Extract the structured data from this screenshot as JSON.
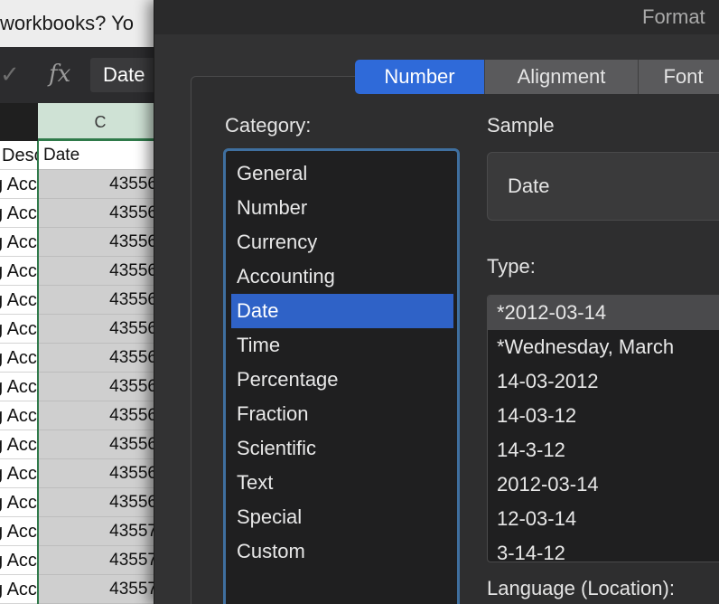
{
  "notice": {
    "text": "workbooks?  Yo"
  },
  "formula_bar": {
    "check_icon": "✓",
    "fx_label": "fx",
    "value": "Date"
  },
  "sheet": {
    "col_c_header": "C",
    "header_row": {
      "a": "Desc",
      "c": "Date"
    },
    "rows": [
      {
        "a": "g Acc",
        "c": "43556"
      },
      {
        "a": "g Acc",
        "c": "43556"
      },
      {
        "a": "g Acc",
        "c": "43556"
      },
      {
        "a": "g Acc",
        "c": "43556"
      },
      {
        "a": "g Acc",
        "c": "43556"
      },
      {
        "a": "g Acc",
        "c": "43556"
      },
      {
        "a": "g Acc",
        "c": "43556"
      },
      {
        "a": "g Acc",
        "c": "43556"
      },
      {
        "a": "g Acc",
        "c": "43556"
      },
      {
        "a": "g Acc",
        "c": "43556"
      },
      {
        "a": "g Acc",
        "c": "43556"
      },
      {
        "a": "g Acc",
        "c": "43556"
      },
      {
        "a": "g Acc",
        "c": "43557"
      },
      {
        "a": "g Acc",
        "c": "43557"
      },
      {
        "a": "g Acc",
        "c": "43557"
      }
    ]
  },
  "dialog": {
    "title": "Format",
    "tabs": [
      {
        "label": "Number",
        "active": true
      },
      {
        "label": "Alignment",
        "active": false
      },
      {
        "label": "Font",
        "active": false
      }
    ],
    "category_label": "Category:",
    "categories": [
      "General",
      "Number",
      "Currency",
      "Accounting",
      "Date",
      "Time",
      "Percentage",
      "Fraction",
      "Scientific",
      "Text",
      "Special",
      "Custom"
    ],
    "selected_category": "Date",
    "sample_label": "Sample",
    "sample_value": "Date",
    "type_label": "Type:",
    "types": [
      "*2012-03-14",
      "*Wednesday, March",
      "14-03-2012",
      "14-03-12",
      "14-3-12",
      "2012-03-14",
      "12-03-14",
      "3-14-12"
    ],
    "selected_type": "*2012-03-14",
    "language_label": "Language (Location):"
  },
  "colors": {
    "accent": "#2f6ad9",
    "selection": "#2f62c7",
    "dialog_bg": "#323233",
    "excel_green": "#2f7a4a"
  }
}
